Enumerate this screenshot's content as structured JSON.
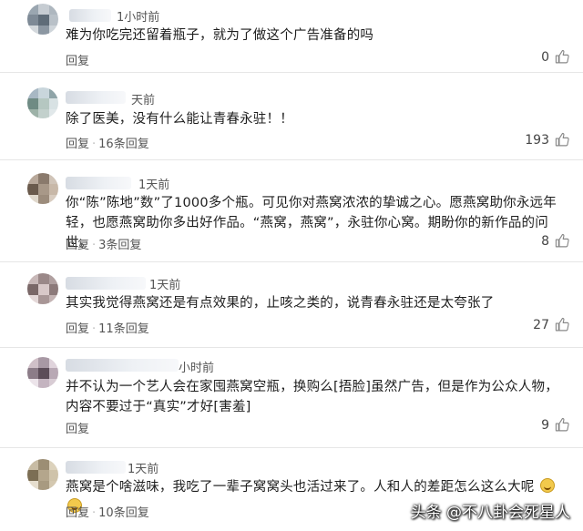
{
  "comments": [
    {
      "time": "1小时前",
      "text": "难为你吃完还留着瓶子，就为了做这个广告准备的吗",
      "reply_label": "回复",
      "replies_label": "",
      "likes": "0"
    },
    {
      "time": "天前",
      "text": "除了医美，没有什么能让青春永驻！！",
      "reply_label": "回复",
      "replies_label": "16条回复",
      "likes": "193"
    },
    {
      "time": "1天前",
      "text": "你“陈”陈地”数”了1000多个瓶。可见你对燕窝浓浓的挚诚之心。愿燕窝助你永远年轻，也愿燕窝助你多出好作品。“燕窝，燕窝”，永驻你心窝。期盼你的新作品的问世。",
      "reply_label": "回复",
      "replies_label": "3条回复",
      "likes": "8"
    },
    {
      "time": "1天前",
      "text": "其实我觉得燕窝还是有点效果的，止咳之类的，说青春永驻还是太夸张了",
      "reply_label": "回复",
      "replies_label": "11条回复",
      "likes": "27"
    },
    {
      "time": "小时前",
      "text": "并不认为一个艺人会在家囤燕窝空瓶，换购么[捂脸]虽然广告，但是作为公众人物，内容不要过于“真实”才好[害羞]",
      "reply_label": "回复",
      "replies_label": "",
      "likes": "9"
    },
    {
      "time": "1天前",
      "text": "燕窝是个啥滋味，我吃了一辈子窝窝头也活过来了。人和人的差距怎么这么大呢",
      "reply_label": "回复",
      "replies_label": "10条回复",
      "likes": ""
    }
  ],
  "watermark": "头条 @不八卦会死星人",
  "icons": {
    "like": "thumb-up-icon"
  },
  "colors": {
    "text": "#1e1e1e",
    "meta": "#555555",
    "divider": "#e6e6e6"
  }
}
